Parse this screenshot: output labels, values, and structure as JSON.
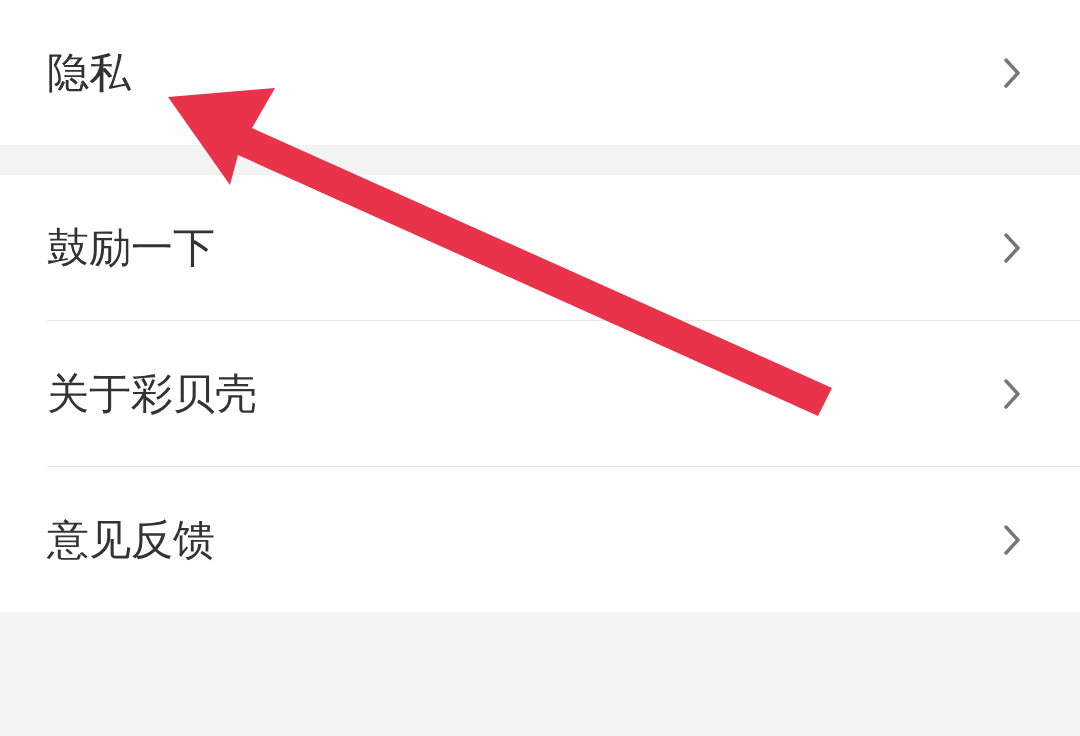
{
  "groups": [
    {
      "items": [
        {
          "label": "隐私"
        }
      ]
    },
    {
      "items": [
        {
          "label": "鼓励一下"
        },
        {
          "label": "关于彩贝壳"
        },
        {
          "label": "意见反馈"
        }
      ]
    }
  ]
}
